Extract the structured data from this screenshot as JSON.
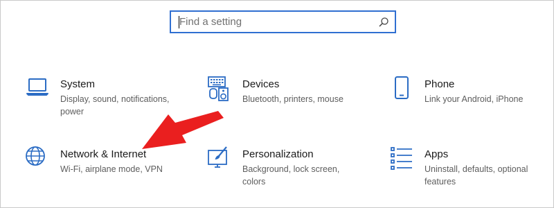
{
  "search": {
    "placeholder": "Find a setting",
    "icon": "search-icon"
  },
  "colors": {
    "accent": "#2f6fd1",
    "icon": "#2b6cc4",
    "arrow": "#ea1f1f"
  },
  "tiles": [
    {
      "title": "System",
      "desc": "Display, sound, notifications, power",
      "icon": "laptop-icon"
    },
    {
      "title": "Devices",
      "desc": "Bluetooth, printers, mouse",
      "icon": "devices-icon"
    },
    {
      "title": "Phone",
      "desc": "Link your Android, iPhone",
      "icon": "phone-icon"
    },
    {
      "title": "Network & Internet",
      "desc": "Wi-Fi, airplane mode, VPN",
      "icon": "globe-icon"
    },
    {
      "title": "Personalization",
      "desc": "Background, lock screen, colors",
      "icon": "paint-icon"
    },
    {
      "title": "Apps",
      "desc": "Uninstall, defaults, optional features",
      "icon": "apps-list-icon"
    }
  ],
  "annotation": {
    "icon": "red-arrow-icon"
  }
}
